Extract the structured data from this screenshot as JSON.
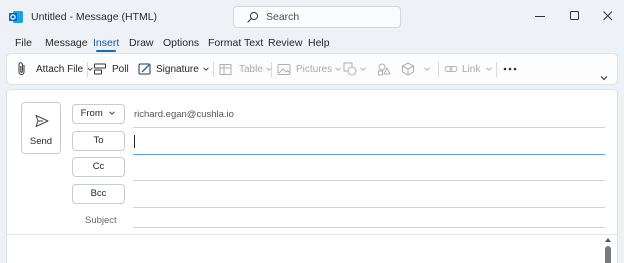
{
  "window": {
    "title": "Untitled  -  Message (HTML)",
    "search_placeholder": "Search",
    "app_icon": "outlook-icon",
    "controls": [
      "minimize-icon",
      "maximize-icon",
      "close-icon"
    ]
  },
  "menu": {
    "items": [
      "File",
      "Message",
      "Insert",
      "Draw",
      "Options",
      "Format Text",
      "Review",
      "Help"
    ],
    "active": "Insert"
  },
  "ribbon": {
    "attach_file": "Attach File",
    "poll": "Poll",
    "signature": "Signature",
    "table": "Table",
    "pictures": "Pictures",
    "link": "Link",
    "disabled": [
      "Table",
      "Pictures",
      "Link"
    ],
    "icons": [
      "paperclip-icon",
      "poll-icon",
      "signature-icon",
      "table-icon",
      "pictures-icon",
      "shapes-icon",
      "icons-icon",
      "3d-models-icon",
      "link-icon",
      "more-options-icon",
      "collapse-ribbon-icon"
    ]
  },
  "compose": {
    "send_label": "Send",
    "from_label": "From",
    "from_address": "richard.egan@cushla.io",
    "to_label": "To",
    "cc_label": "Cc",
    "bcc_label": "Bcc",
    "subject_label": "Subject",
    "to_value": "",
    "cc_value": "",
    "bcc_value": "",
    "subject_value": ""
  },
  "colors": {
    "accent": "#0f6cbd",
    "background": "#eef1f5",
    "surface": "#ffffff"
  }
}
